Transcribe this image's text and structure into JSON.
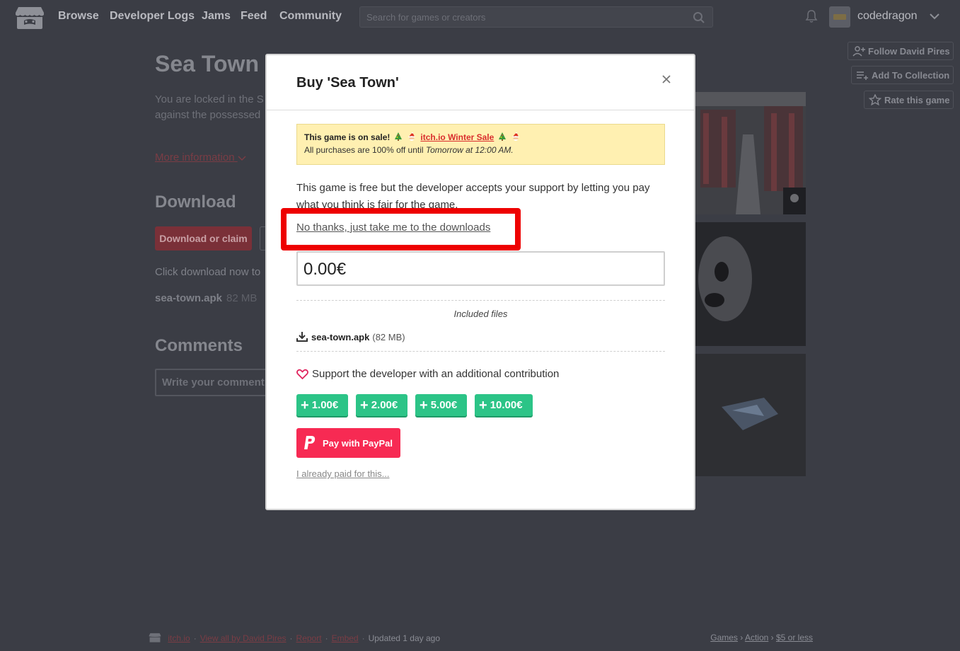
{
  "nav": {
    "links": [
      "Browse",
      "Developer Logs",
      "Jams",
      "Feed",
      "Community"
    ],
    "search_placeholder": "Search for games or creators",
    "username": "codedragon"
  },
  "side_actions": {
    "follow": "Follow David Pires",
    "add_to_collection": "Add To Collection",
    "rate": "Rate this game"
  },
  "background": {
    "title": "Sea Town",
    "description_line1": "You are locked in the S",
    "description_line2": "against the possessed",
    "more_info": "More information",
    "download_heading": "Download",
    "download_button": "Download or claim",
    "click_text": "Click download now to",
    "file_name": "sea-town.apk",
    "file_size": "82 MB",
    "comments_heading": "Comments",
    "comment_placeholder": "Write your comment"
  },
  "modal": {
    "title": "Buy 'Sea Town'",
    "sale": {
      "prefix": "This game is on sale!",
      "link": "itch.io Winter Sale",
      "line2_prefix": "All purchases are 100% off until ",
      "line2_time": "Tomorrow at 12:00 AM."
    },
    "free_text": "This game is free but the developer accepts your support by letting you pay what you think is fair for the game.",
    "no_thanks": "No thanks, just take me to the downloads",
    "price_value": "0.00€",
    "included_files_label": "Included files",
    "file": {
      "name": "sea-town.apk",
      "size": "(82 MB)"
    },
    "support_text": "Support the developer with an additional contribution",
    "tips": [
      "1.00€",
      "2.00€",
      "5.00€",
      "10.00€"
    ],
    "paypal_button": "Pay with PayPal",
    "already_paid": "I already paid for this..."
  },
  "footer": {
    "left": [
      "itch.io",
      "View all by David Pires",
      "Report",
      "Embed"
    ],
    "updated": "Updated 1 day ago",
    "breadcrumbs": [
      "Games",
      "Action",
      "$5 or less"
    ]
  },
  "colors": {
    "page_bg": "#3b3d45",
    "sale_bg": "#fff0b1",
    "tip_green": "#2cc487",
    "paypal_red": "#f72a53",
    "highlight_red": "#ee0000"
  }
}
